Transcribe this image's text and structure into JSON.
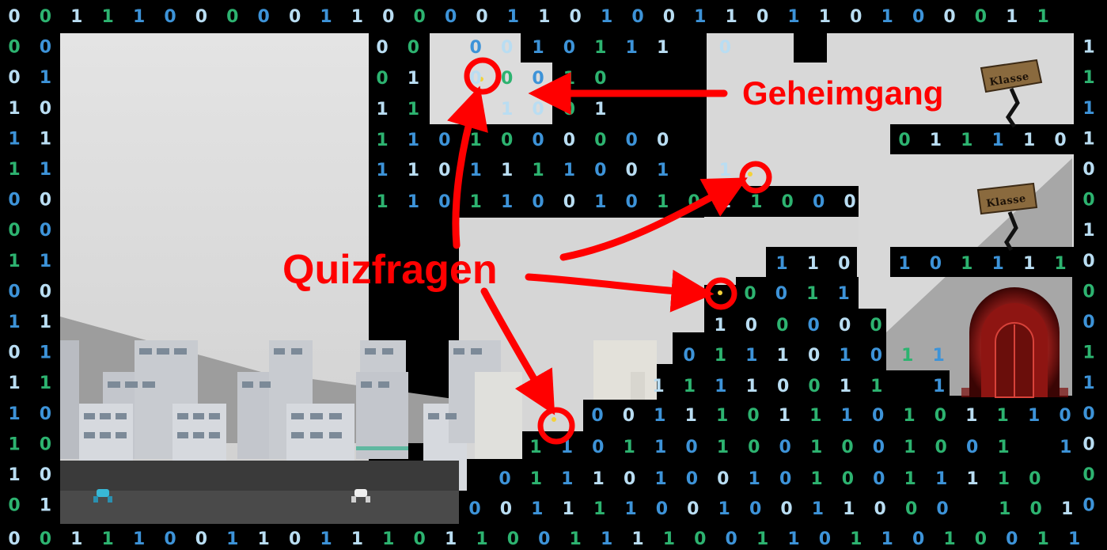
{
  "annotations": {
    "secret_passage_label": "Geheimgang",
    "quiz_label": "Quizfragen"
  },
  "signs": {
    "upper": "Klasse",
    "lower": "Klasse"
  },
  "colors": {
    "annotation": "#ff0000",
    "digit_light": "#b9ddf2",
    "digit_green": "#2db370",
    "digit_blue": "#3d93d8",
    "background_sky": "#d9d9d9",
    "door_glow": "#c0201c"
  },
  "binary_rows": [
    "0011100000110000110100110110100011",
    "00",
    "01",
    "10",
    "11",
    "11",
    "00",
    "00",
    "11",
    "00",
    "11",
    "01",
    "11",
    "10",
    "10",
    "10",
    "01",
    "001110011011101100111100110110100111"
  ],
  "binary_right_column": "0111100100011000000111110000000010001",
  "binary_blocks": {
    "top_block_row1": "00 0010111 0",
    "top_block_row2": "01 00010",
    "top_block_row3": "11 01001",
    "top_block_row4": "1101000000",
    "top_block_row5": "1101111001 1",
    "top_block_row6": "1101100101011000",
    "right_ledge_1": "0111101",
    "right_ledge_2": "1011110",
    "step_1": "110",
    "step_2": "0011",
    "step_3": "100000",
    "step_4": "011101011",
    "step_5": "11110011 1",
    "step_6": "0011101110101110 0",
    "step_7": "1101101001001001 1",
    "step_8": "011101001010011110 0",
    "step_9": "0011110010011000 1011"
  }
}
